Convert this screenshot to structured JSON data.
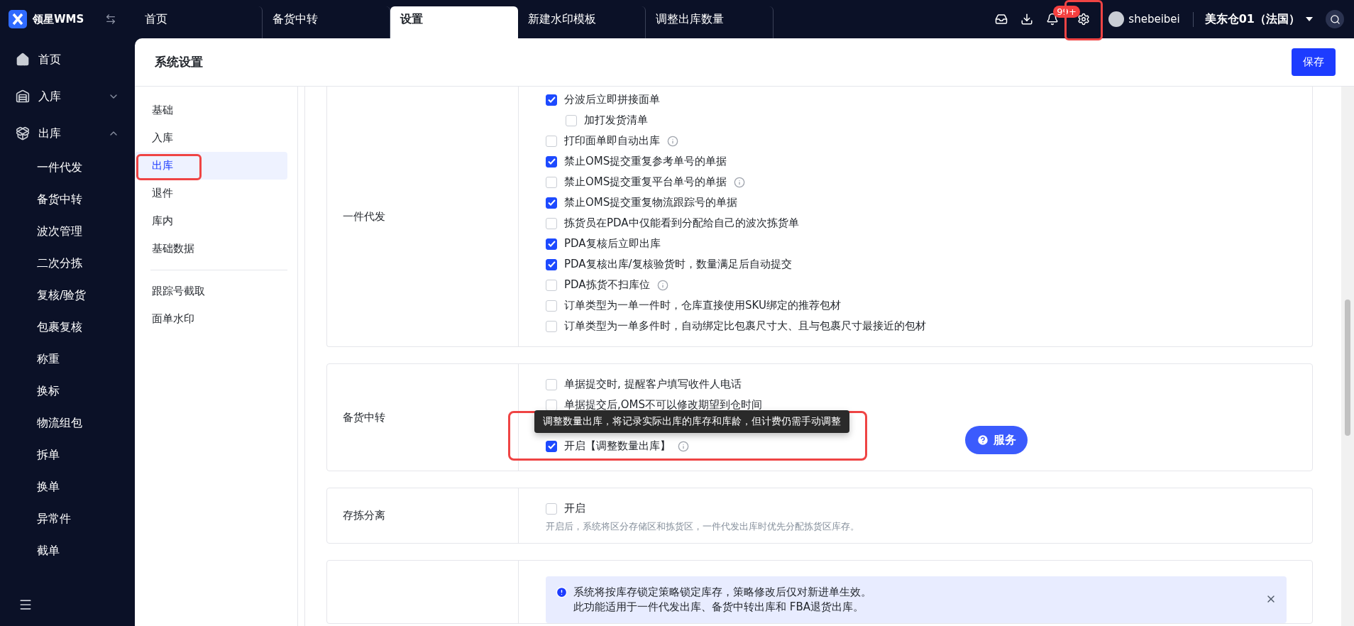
{
  "app": {
    "logo_text": "领星WMS"
  },
  "tabs": [
    {
      "label": "首页",
      "selected": false
    },
    {
      "label": "备货中转",
      "selected": false
    },
    {
      "label": "设置",
      "selected": true
    },
    {
      "label": "新建水印模板",
      "selected": false
    },
    {
      "label": "调整出库数量",
      "selected": false
    }
  ],
  "topbar": {
    "notification_badge": "99+",
    "settings_highlighted": true,
    "username": "shebeibei",
    "warehouse": "美东仓01（法国）"
  },
  "sidebar": {
    "items": [
      {
        "label": "首页",
        "kind": "home"
      },
      {
        "label": "入库",
        "kind": "inbound",
        "expanded": false
      },
      {
        "label": "出库",
        "kind": "outbound",
        "expanded": true,
        "children": [
          "一件代发",
          "备货中转",
          "波次管理",
          "二次分拣",
          "复核/验货",
          "包裹复核",
          "称重",
          "换标",
          "物流组包",
          "拆单",
          "换单",
          "异常件",
          "截单"
        ]
      }
    ]
  },
  "page": {
    "title": "系统设置",
    "save_button": "保存"
  },
  "subnav": {
    "groups": [
      [
        {
          "label": "基础",
          "selected": false,
          "highlighted": false
        },
        {
          "label": "入库",
          "selected": false,
          "highlighted": false
        },
        {
          "label": "出库",
          "selected": true,
          "highlighted": true
        },
        {
          "label": "退件",
          "selected": false,
          "highlighted": false
        },
        {
          "label": "库内",
          "selected": false,
          "highlighted": false
        },
        {
          "label": "基础数据",
          "selected": false,
          "highlighted": false
        }
      ],
      [
        {
          "label": "跟踪号截取",
          "selected": false,
          "highlighted": false
        },
        {
          "label": "面单水印",
          "selected": false,
          "highlighted": false
        }
      ]
    ]
  },
  "sections": [
    {
      "label": "一件代发",
      "options": [
        {
          "label": "分波后立即拼接面单",
          "checked": true,
          "info": false,
          "children": [
            {
              "label": "加打发货清单",
              "checked": false
            }
          ]
        },
        {
          "label": "打印面单即自动出库",
          "checked": false,
          "info": true
        },
        {
          "label": "禁止OMS提交重复参考单号的单据",
          "checked": true,
          "info": false
        },
        {
          "label": "禁止OMS提交重复平台单号的单据",
          "checked": false,
          "info": true
        },
        {
          "label": "禁止OMS提交重复物流跟踪号的单据",
          "checked": true,
          "info": false
        },
        {
          "label": "拣货员在PDA中仅能看到分配给自己的波次拣货单",
          "checked": false,
          "info": false
        },
        {
          "label": "PDA复核后立即出库",
          "checked": true,
          "info": false
        },
        {
          "label": "PDA复核出库/复核验货时，数量满足后自动提交",
          "checked": true,
          "info": false
        },
        {
          "label": "PDA拣货不扫库位",
          "checked": false,
          "info": true
        },
        {
          "label": "订单类型为一单一件时，仓库直接使用SKU绑定的推荐包材",
          "checked": false,
          "info": false
        },
        {
          "label": "订单类型为一单多件时，自动绑定比包裹尺寸大、且与包裹尺寸最接近的包材",
          "checked": false,
          "info": false
        }
      ]
    },
    {
      "label": "备货中转",
      "options": [
        {
          "label": "单据提交时, 提醒客户填写收件人电话",
          "checked": false,
          "info": false,
          "highlighted": false
        },
        {
          "label": "单据提交后,OMS不可以修改期望到仓时间",
          "checked": false,
          "info": false,
          "highlighted": false
        },
        {
          "highlighted": true
        },
        {
          "label": "开启【调整数量出库】",
          "checked": true,
          "info": true,
          "highlighted": true,
          "tooltip": "调整数量出库，将记录实际出库的库存和库龄，但计费仍需手动调整"
        }
      ]
    },
    {
      "label": "存拣分离",
      "options": [
        {
          "label": "开启",
          "checked": false,
          "info": false
        }
      ],
      "hint": "开启后，系统将区分存储区和拣货区，一件代发出库时优先分配拣货区库存。"
    },
    {
      "alert": [
        "系统将按库存锁定策略锁定库存，策略修改后仅对新进单生效。",
        "此功能适用于一件代发出库、备货中转出库和 FBA退货出库。"
      ]
    }
  ],
  "service_button": "服务"
}
